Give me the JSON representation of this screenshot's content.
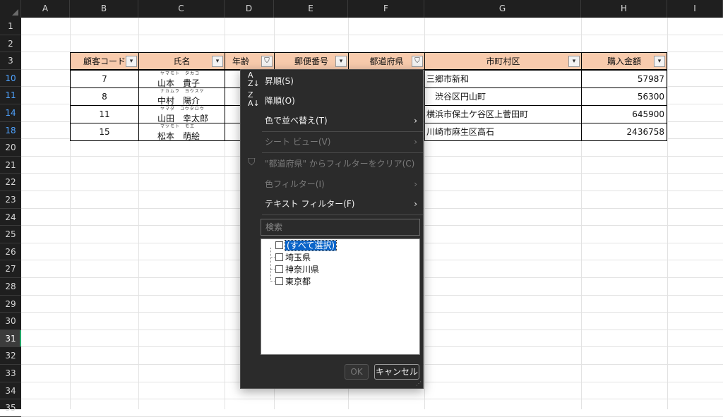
{
  "columns": [
    "A",
    "B",
    "C",
    "D",
    "E",
    "F",
    "G",
    "H",
    "I"
  ],
  "rows": [
    {
      "num": "1",
      "state": "normal"
    },
    {
      "num": "2",
      "state": "normal"
    },
    {
      "num": "3",
      "state": "normal"
    },
    {
      "num": "10",
      "state": "filtered"
    },
    {
      "num": "11",
      "state": "filtered"
    },
    {
      "num": "14",
      "state": "filtered"
    },
    {
      "num": "18",
      "state": "filtered"
    },
    {
      "num": "20",
      "state": "normal"
    },
    {
      "num": "21",
      "state": "normal"
    },
    {
      "num": "22",
      "state": "normal"
    },
    {
      "num": "23",
      "state": "normal"
    },
    {
      "num": "24",
      "state": "normal"
    },
    {
      "num": "25",
      "state": "normal"
    },
    {
      "num": "26",
      "state": "normal"
    },
    {
      "num": "27",
      "state": "normal"
    },
    {
      "num": "28",
      "state": "normal"
    },
    {
      "num": "29",
      "state": "normal"
    },
    {
      "num": "30",
      "state": "normal"
    },
    {
      "num": "31",
      "state": "active"
    },
    {
      "num": "32",
      "state": "normal"
    },
    {
      "num": "33",
      "state": "normal"
    },
    {
      "num": "34",
      "state": "normal"
    },
    {
      "num": "35",
      "state": "normal"
    }
  ],
  "table": {
    "headers": [
      "顧客コード",
      "氏名",
      "年齢",
      "郵便番号",
      "都道府県",
      "市町村区",
      "購入金額"
    ],
    "header_filter_icons": [
      "▾",
      "▾",
      "⛉",
      "▾",
      "⛉",
      "▾",
      "▾"
    ],
    "records": [
      {
        "code": "7",
        "ruby": "ヤマモト　タカコ",
        "name": "山本　貴子",
        "city": "三郷市新和",
        "amount": "57987"
      },
      {
        "code": "8",
        "ruby": "ナカムラ　ヨウスケ",
        "name": "中村　陽介",
        "city": "　渋谷区円山町",
        "amount": "56300"
      },
      {
        "code": "11",
        "ruby": "ヤマダ　コウタロウ",
        "name": "山田　幸太郎",
        "city": "横浜市保土ケ谷区上菅田町",
        "amount": "645900"
      },
      {
        "code": "15",
        "ruby": "マツモト　モエ",
        "name": "松本　萌絵",
        "city": "川崎市麻生区高石",
        "amount": "2436758"
      }
    ]
  },
  "menu": {
    "sort_asc": "昇順(S)",
    "sort_desc": "降順(O)",
    "sort_by_color": "色で並べ替え(T)",
    "sheet_view": "シート ビュー(V)",
    "clear_filter": "\"都道府県\" からフィルターをクリア(C)",
    "color_filter": "色フィルター(I)",
    "text_filter": "テキスト フィルター(F)",
    "search_placeholder": "検索",
    "items": [
      "(すべて選択)",
      "埼玉県",
      "神奈川県",
      "東京都"
    ],
    "ok": "OK",
    "cancel": "キャンセル"
  },
  "colors": {
    "header_fill": "#f8cbad",
    "menu_bg": "#2b2b2b",
    "filtered_row": "#4fa3ff",
    "active_indicator": "#21a366"
  }
}
